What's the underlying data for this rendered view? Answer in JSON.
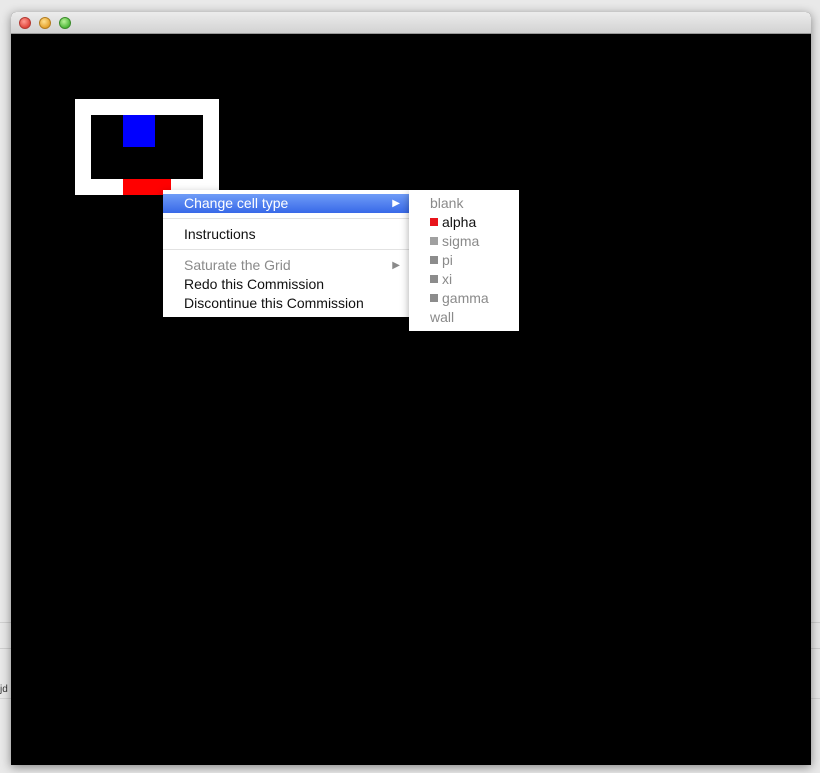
{
  "background_app": {
    "fragment": "jd"
  },
  "window": {
    "title": ""
  },
  "canvas": {
    "background": "#000000"
  },
  "grid_colors": {
    "border": "#ffffff",
    "blue_cell": "#0000ff",
    "red_cell": "#ff0000"
  },
  "context_menu": {
    "items": [
      {
        "label": "Change cell type",
        "highlighted": true,
        "enabled": true,
        "has_submenu": true
      },
      {
        "label": "Instructions",
        "enabled": true
      },
      {
        "label": "Saturate the Grid",
        "enabled": false,
        "has_submenu": true
      },
      {
        "label": "Redo this Commission",
        "enabled": true
      },
      {
        "label": "Discontinue this Commission",
        "enabled": true
      }
    ],
    "submenu_arrow": "▶"
  },
  "cell_type_submenu": {
    "items": [
      {
        "label": "blank",
        "enabled": false
      },
      {
        "label": "alpha",
        "enabled": true,
        "swatch_color": "#e8141b"
      },
      {
        "label": "sigma",
        "enabled": false,
        "swatch_color": "#a0a0a0"
      },
      {
        "label": "pi",
        "enabled": false,
        "swatch_color": "#8c8c8c"
      },
      {
        "label": "xi",
        "enabled": false,
        "swatch_color": "#8c8c8c"
      },
      {
        "label": "gamma",
        "enabled": false,
        "swatch_color": "#8c8c8c"
      },
      {
        "label": "wall",
        "enabled": false
      }
    ]
  }
}
